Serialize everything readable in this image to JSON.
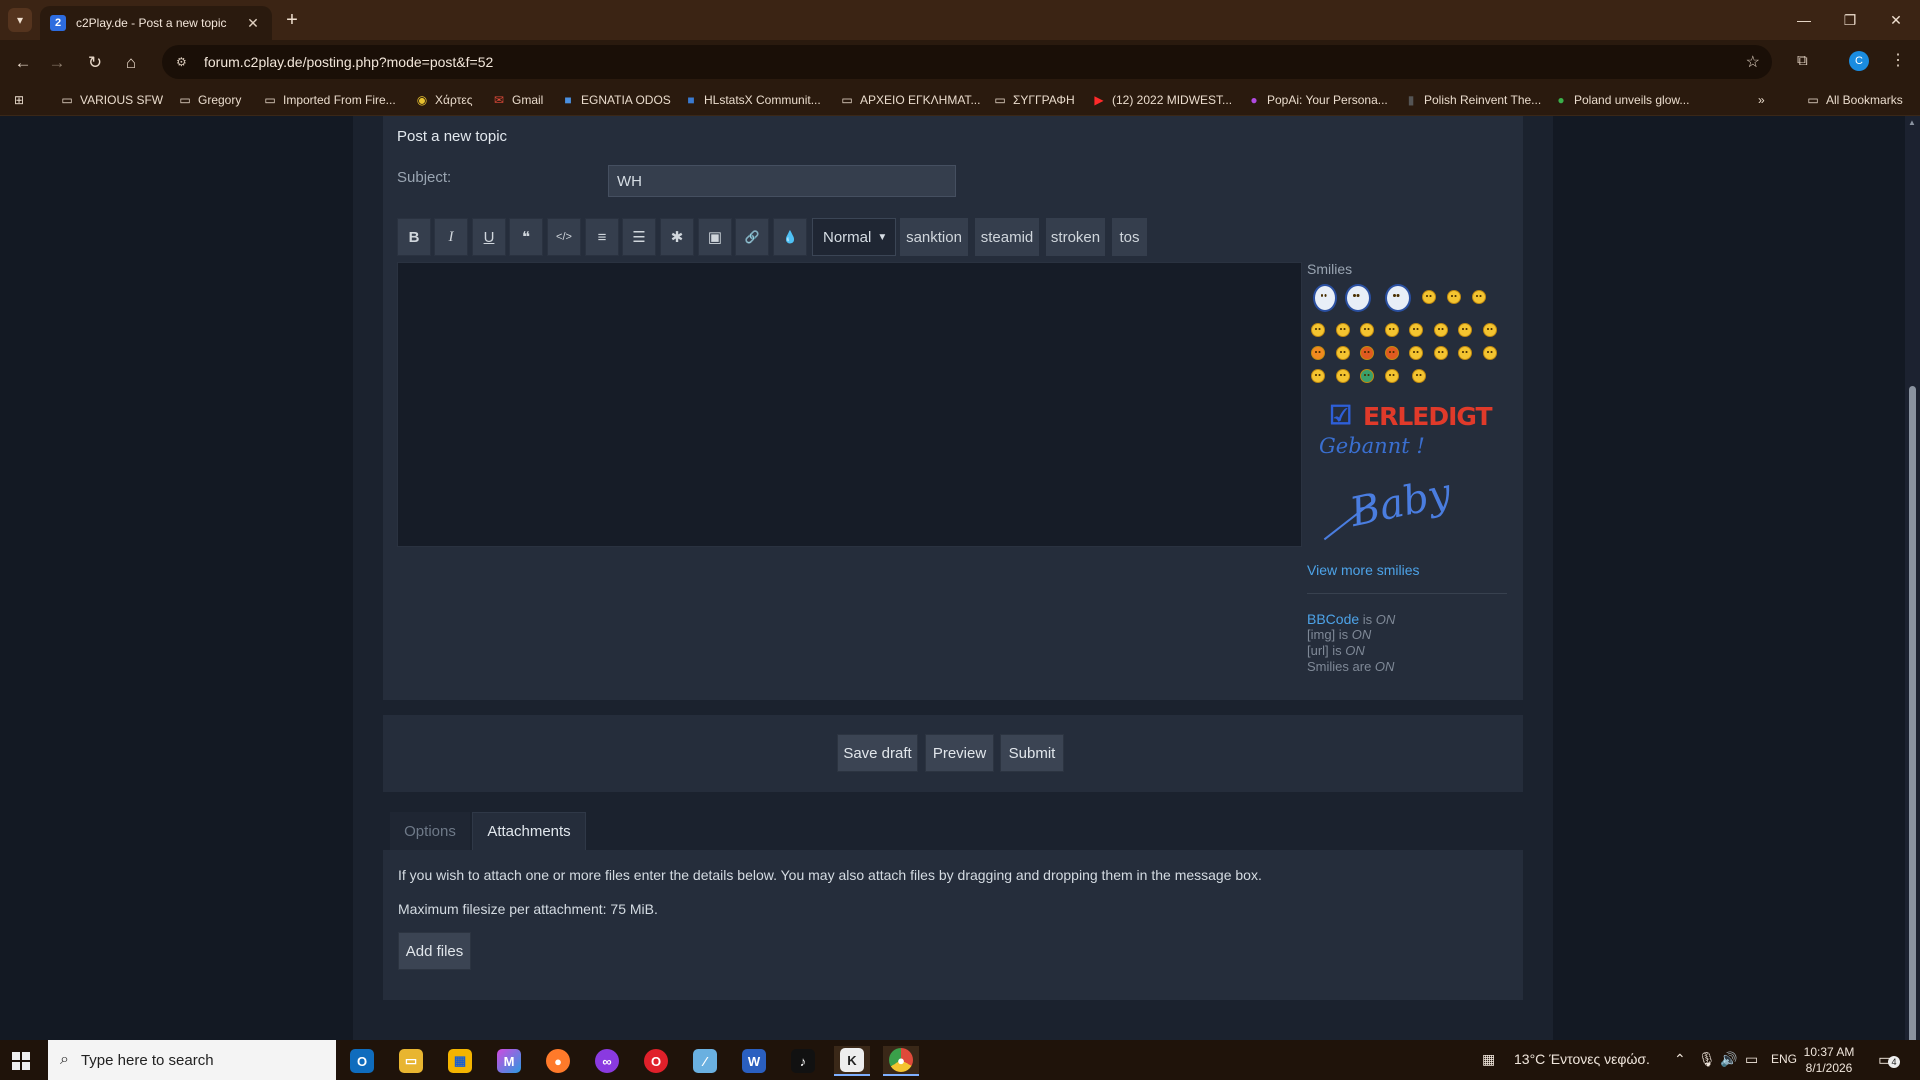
{
  "browser": {
    "tab": {
      "favicon": "2",
      "title": "c2Play.de - Post a new topic",
      "close": "✕"
    },
    "new_tab": "+",
    "window": {
      "minimize": "—",
      "restore": "❐",
      "close": "✕"
    },
    "nav": {
      "back": "←",
      "forward": "→",
      "reload": "↻",
      "home": "⌂"
    },
    "url": "forum.c2play.de/posting.php?mode=post&f=52",
    "profile_initial": "C",
    "bookmarks": [
      {
        "label": "VARIOUS SFW",
        "icon": "folder-icon"
      },
      {
        "label": "Gregory",
        "icon": "folder-icon"
      },
      {
        "label": "Imported From Fire...",
        "icon": "folder-icon"
      },
      {
        "label": "Χάρτες",
        "icon": "maps-icon"
      },
      {
        "label": "Gmail",
        "icon": "gmail-icon"
      },
      {
        "label": "EGNATIA ODOS",
        "icon": "egnatia-icon"
      },
      {
        "label": "HLstatsX Communit...",
        "icon": "hlstats-icon"
      },
      {
        "label": "ΑΡΧΕΙΟ ΕΓΚΛΗΜΑΤ...",
        "icon": "folder-icon"
      },
      {
        "label": "ΣΥΓΓΡΑΦΗ",
        "icon": "folder-icon"
      },
      {
        "label": "(12) 2022 MIDWEST...",
        "icon": "youtube-icon"
      },
      {
        "label": "PopAi: Your Persona...",
        "icon": "popai-icon"
      },
      {
        "label": "Polish Reinvent The...",
        "icon": "page-icon"
      },
      {
        "label": "Poland unveils glow...",
        "icon": "globe-icon"
      }
    ],
    "bookmarks_overflow": "»",
    "all_bookmarks": "All Bookmarks"
  },
  "form": {
    "panel_title": "Post a new topic",
    "subject_label": "Subject:",
    "subject_value": "WH",
    "toolbar": {
      "bold": "B",
      "italic": "I",
      "underline": "U",
      "quote": "❝",
      "code": "</>",
      "list": "≡",
      "list_numbered": "☰",
      "list_item": "✱",
      "image": "▣",
      "link": "🔗",
      "color": "💧",
      "font_size": "Normal",
      "custom": [
        "sanktion",
        "steamid",
        "stroken",
        "tos"
      ]
    },
    "message_value": ""
  },
  "smilies": {
    "title": "Smilies",
    "view_more": "View more smilies",
    "erledigt_word": "ERLEDIGT",
    "erledigt_script": "Gebannt !",
    "baby_script": "Baby"
  },
  "bbcode_status": {
    "bbcode_link": "BBCode",
    "is": " is ",
    "on": "ON",
    "img": "[img] is ",
    "url": "[url] is ",
    "smilies": "Smilies are "
  },
  "actions": {
    "save_draft": "Save draft",
    "preview": "Preview",
    "submit": "Submit"
  },
  "tabs": {
    "options": "Options",
    "attachments": "Attachments"
  },
  "attachments": {
    "help": "If you wish to attach one or more files enter the details below. You may also attach files by dragging and dropping them in the message box.",
    "max_size": "Maximum filesize per attachment: 75 MiB.",
    "add_files": "Add files"
  },
  "taskbar": {
    "search_placeholder": "Type here to search",
    "apps": [
      "outlook",
      "file-explorer",
      "store",
      "microsoft-365",
      "firefox",
      "app-purple",
      "opera",
      "app-feather",
      "word",
      "tiktok",
      "counter-strike",
      "chrome"
    ],
    "weather": "13°C  Έντονες νεφώσ.",
    "language": "ENG",
    "time": "10:37 AM",
    "date": "8/1/2026",
    "notifications": "4"
  }
}
